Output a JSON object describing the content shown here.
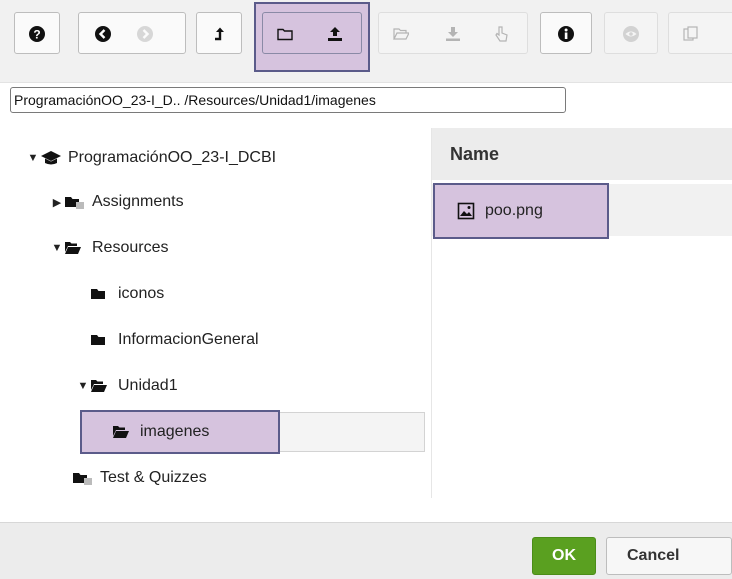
{
  "toolbar": {
    "buttons": [
      {
        "icon": "help-icon"
      },
      {
        "icon": "back-icon"
      },
      {
        "icon": "forward-icon"
      },
      {
        "icon": "up-icon"
      },
      {
        "icon": "new-folder-icon"
      },
      {
        "icon": "upload-icon"
      },
      {
        "icon": "open-folder-icon"
      },
      {
        "icon": "download-icon"
      },
      {
        "icon": "select-icon"
      },
      {
        "icon": "info-icon"
      },
      {
        "icon": "preview-icon"
      },
      {
        "icon": "copy-icon"
      }
    ],
    "highlight_color": "#d6c3de"
  },
  "path": "ProgramaciónOO_23-I_D.. /Resources/Unidad1/imagenes",
  "tree": {
    "root": "ProgramaciónOO_23-I_DCBI",
    "items": [
      {
        "label": "Assignments"
      },
      {
        "label": "Resources"
      },
      {
        "label": "iconos"
      },
      {
        "label": "InformacionGeneral"
      },
      {
        "label": "Unidad1"
      },
      {
        "label": "imagenes"
      },
      {
        "label": "Test & Quizzes"
      }
    ]
  },
  "files": {
    "header": "Name",
    "rows": [
      {
        "name": "poo.png"
      }
    ]
  },
  "footer": {
    "ok_label": "OK",
    "cancel_label": "Cancel",
    "ok_color": "#5aa020"
  }
}
